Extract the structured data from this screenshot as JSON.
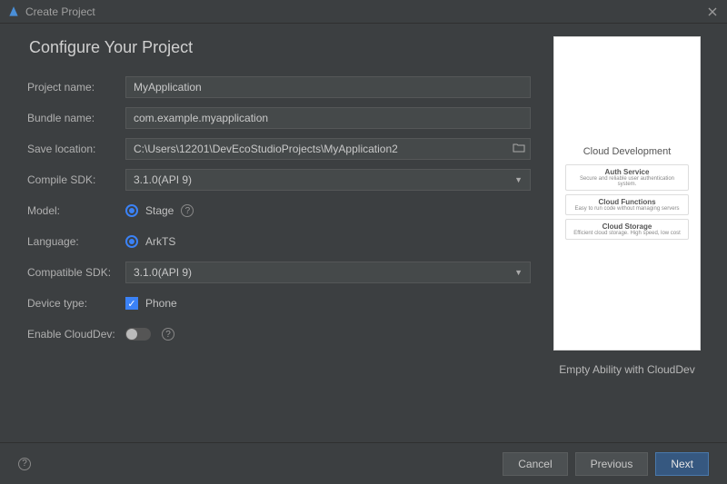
{
  "window": {
    "title": "Create Project"
  },
  "page": {
    "heading": "Configure Your Project"
  },
  "labels": {
    "projectName": "Project name:",
    "bundleName": "Bundle name:",
    "saveLocation": "Save location:",
    "compileSdk": "Compile SDK:",
    "model": "Model:",
    "language": "Language:",
    "compatibleSdk": "Compatible SDK:",
    "deviceType": "Device type:",
    "enableCloudDev": "Enable CloudDev:"
  },
  "values": {
    "projectName": "MyApplication",
    "bundleName": "com.example.myapplication",
    "saveLocation": "C:\\Users\\12201\\DevEcoStudioProjects\\MyApplication2",
    "compileSdk": "3.1.0(API 9)",
    "model": "Stage",
    "language": "ArkTS",
    "compatibleSdk": "3.1.0(API 9)",
    "deviceType": "Phone",
    "enableCloudDev": false
  },
  "preview": {
    "title": "Cloud Development",
    "cards": [
      {
        "title": "Auth Service",
        "sub": "Secure and reliable user authentication system."
      },
      {
        "title": "Cloud Functions",
        "sub": "Easy to run code without managing servers"
      },
      {
        "title": "Cloud Storage",
        "sub": "Efficient cloud storage. High speed, low cost"
      }
    ],
    "caption": "Empty Ability with CloudDev"
  },
  "footer": {
    "cancel": "Cancel",
    "previous": "Previous",
    "next": "Next"
  }
}
